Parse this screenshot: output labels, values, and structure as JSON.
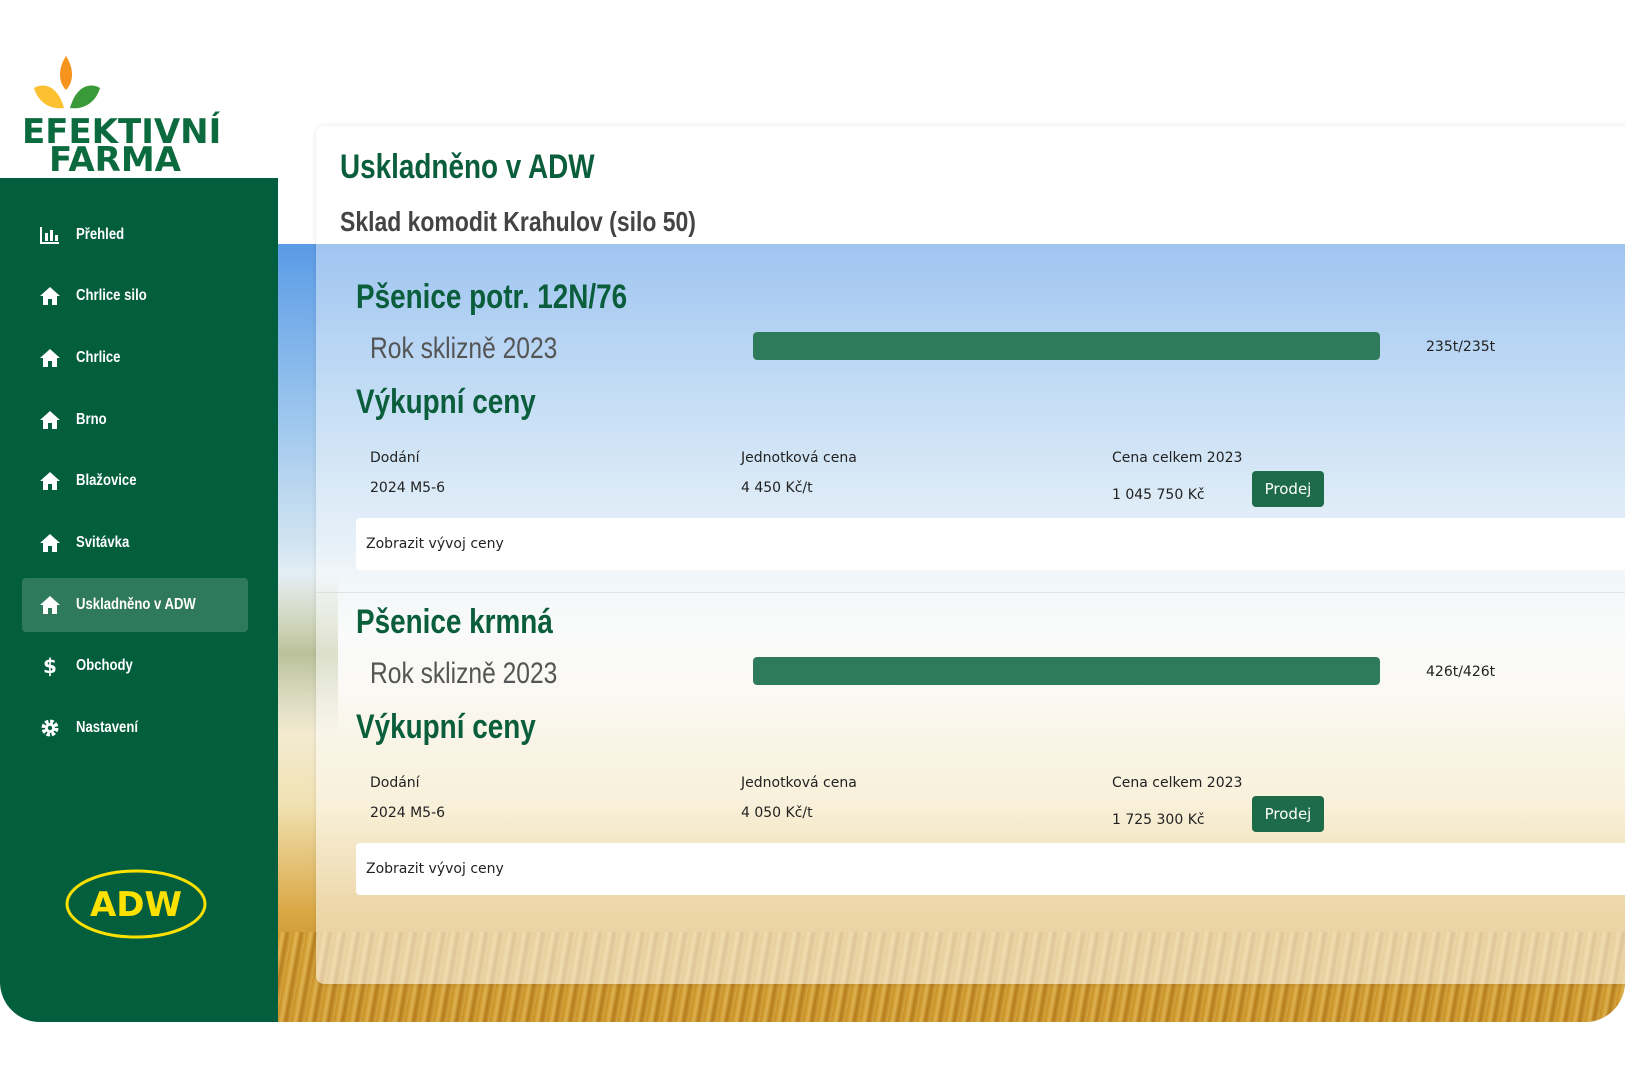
{
  "logo": {
    "line1": "EFEKTIVNÍ",
    "line2": "FARMA"
  },
  "sidebar": {
    "items": [
      {
        "label": "Přehled",
        "icon": "chart-icon"
      },
      {
        "label": "Chrlice silo",
        "icon": "home-icon"
      },
      {
        "label": "Chrlice",
        "icon": "home-icon"
      },
      {
        "label": "Brno",
        "icon": "home-icon"
      },
      {
        "label": "Blažovice",
        "icon": "home-icon"
      },
      {
        "label": "Svitávka",
        "icon": "home-icon"
      },
      {
        "label": "Uskladněno v ADW",
        "icon": "home-icon",
        "active": true
      },
      {
        "label": "Obchody",
        "icon": "dollar-icon"
      },
      {
        "label": "Nastavení",
        "icon": "gear-icon"
      }
    ],
    "partner_logo": "ADW"
  },
  "main": {
    "title": "Uskladněno v ADW",
    "subtitle": "Sklad komodit Krahulov (silo 50)",
    "commodities": [
      {
        "name": "Pšenice potr. 12N/76",
        "harvest_year": "Rok sklizně 2023",
        "progress_fraction": 1.0,
        "progress_text": "235t/235t",
        "prices_heading": "Výkupní ceny",
        "col_delivery": "Dodání",
        "col_unit_price": "Jednotková cena",
        "col_total": "Cena celkem 2023",
        "delivery": "2024 M5-6",
        "unit_price": "4 450 Kč/t",
        "total": "1 045 750 Kč",
        "sell_label": "Prodej",
        "history_label": "Zobrazit vývoj ceny"
      },
      {
        "name": "Pšenice krmná",
        "harvest_year": "Rok sklizně 2023",
        "progress_fraction": 1.0,
        "progress_text": "426t/426t",
        "prices_heading": "Výkupní ceny",
        "col_delivery": "Dodání",
        "col_unit_price": "Jednotková cena",
        "col_total": "Cena celkem 2023",
        "delivery": "2024 M5-6",
        "unit_price": "4 050 Kč/t",
        "total": "1 725 300 Kč",
        "sell_label": "Prodej",
        "history_label": "Zobrazit vývoj ceny"
      }
    ]
  },
  "colors": {
    "brand_green": "#025e3c",
    "active_item": "#2f7a5c",
    "progress": "#2e7b5b",
    "button": "#1d6b48",
    "logo_orange": "#f7941d",
    "logo_yellow": "#fdc030",
    "adw_yellow": "#fde100"
  }
}
